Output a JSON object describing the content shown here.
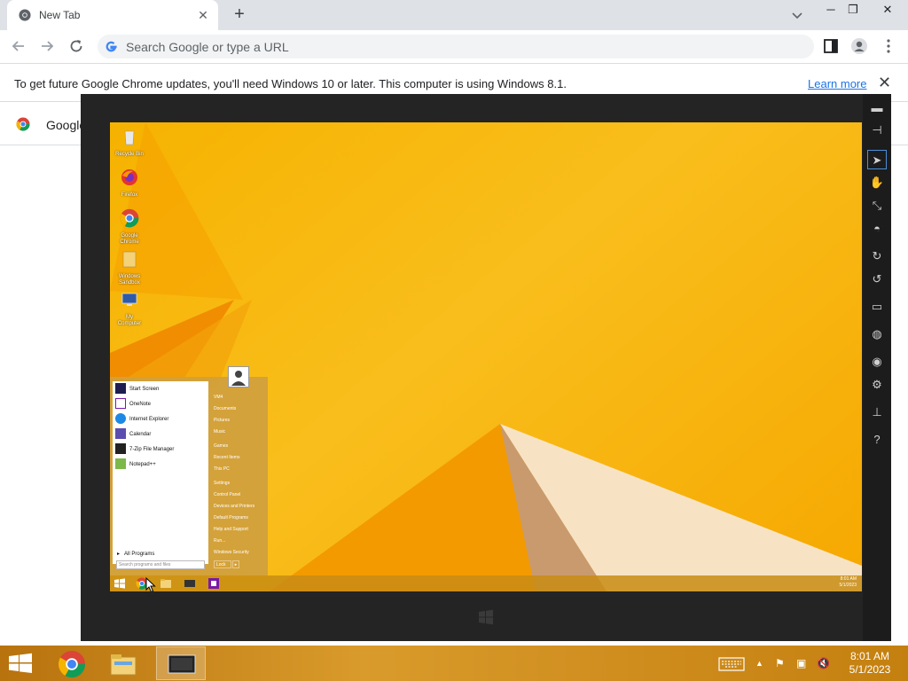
{
  "browser": {
    "tab": {
      "title": "New Tab"
    },
    "new_tab_label": "+",
    "omnibox": {
      "placeholder": "Search Google or type a URL"
    },
    "infobar": {
      "message": "To get future Google Chrome updates, you'll need Windows 10 or later. This computer is using Windows 8.1.",
      "link": "Learn more"
    },
    "bookmark": {
      "label": "Google"
    }
  },
  "remote_desktop": {
    "icons": [
      {
        "label": "Recycle Bin"
      },
      {
        "label": "Firefox"
      },
      {
        "label": "Google Chrome"
      },
      {
        "label": "Windows Sandbox"
      },
      {
        "label": "My Computer"
      }
    ],
    "start_menu": {
      "items": [
        {
          "label": "Start Screen"
        },
        {
          "label": "OneNote"
        },
        {
          "label": "Internet Explorer"
        },
        {
          "label": "Calendar"
        },
        {
          "label": "7-Zip File Manager"
        },
        {
          "label": "Notepad++"
        }
      ],
      "all_programs": "All Programs",
      "search_placeholder": "Search programs and files",
      "right_items": [
        {
          "label": "VM4"
        },
        {
          "label": "Documents"
        },
        {
          "label": "Pictures"
        },
        {
          "label": "Music"
        },
        {
          "label": "Games"
        },
        {
          "label": "Recent Items"
        },
        {
          "label": "This PC"
        },
        {
          "label": "Settings"
        },
        {
          "label": "Control Panel"
        },
        {
          "label": "Devices and Printers"
        },
        {
          "label": "Default Programs"
        },
        {
          "label": "Help and Support"
        },
        {
          "label": "Run..."
        },
        {
          "label": "Windows Security"
        }
      ],
      "shutdown_label": "Lock"
    },
    "tray": {
      "time": "8:01 AM",
      "date": "5/1/2023"
    }
  },
  "taskbar": {
    "time": "8:01 AM",
    "date": "5/1/2023"
  },
  "colors": {
    "accent": "#1a73e8",
    "taskbar": "#d99b2b",
    "remote_bg": "#f6b200"
  }
}
